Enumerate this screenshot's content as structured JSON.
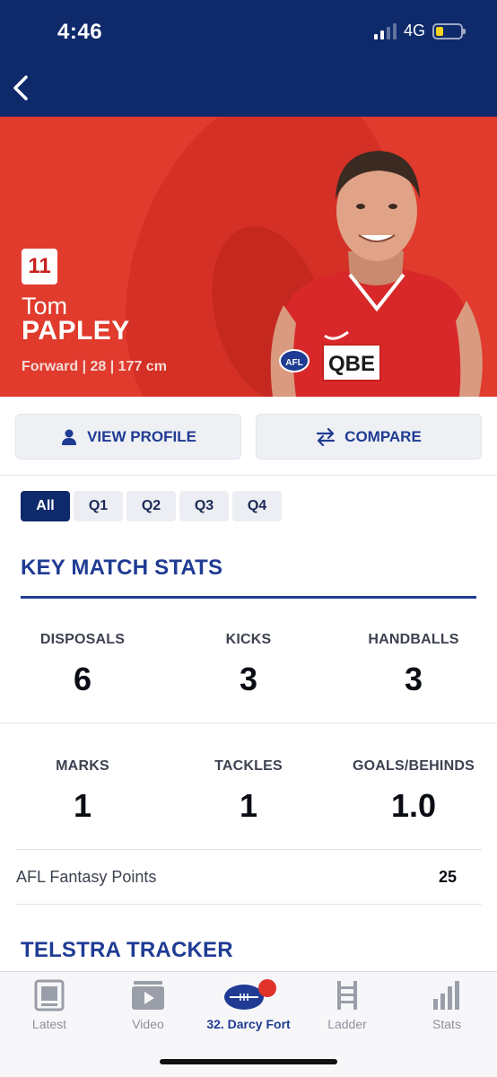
{
  "status_bar": {
    "time": "4:46",
    "network": "4G"
  },
  "header": {
    "back_icon": "chevron-left-icon"
  },
  "player": {
    "number": "11",
    "first_name": "Tom",
    "last_name": "PAPLEY",
    "meta": "Forward | 28 | 177 cm",
    "jersey_text": "QBE",
    "badge_text": "AFL"
  },
  "actions": {
    "view_profile": "VIEW PROFILE",
    "compare": "COMPARE"
  },
  "quarter_tabs": [
    "All",
    "Q1",
    "Q2",
    "Q3",
    "Q4"
  ],
  "selected_tab": "All",
  "key_match_stats": {
    "title": "KEY MATCH STATS",
    "row1": [
      {
        "label": "DISPOSALS",
        "value": "6"
      },
      {
        "label": "KICKS",
        "value": "3"
      },
      {
        "label": "HANDBALLS",
        "value": "3"
      }
    ],
    "row2": [
      {
        "label": "MARKS",
        "value": "1"
      },
      {
        "label": "TACKLES",
        "value": "1"
      },
      {
        "label": "GOALS/BEHINDS",
        "value": "1.0"
      }
    ],
    "fantasy_label": "AFL Fantasy Points",
    "fantasy_value": "25"
  },
  "tracker": {
    "title": "TELSTRA TRACKER"
  },
  "bottom_nav": [
    {
      "label": "Latest",
      "icon": "news-icon"
    },
    {
      "label": "Video",
      "icon": "video-icon"
    },
    {
      "label": "32. Darcy Fort",
      "icon": "football-icon"
    },
    {
      "label": "Ladder",
      "icon": "ladder-icon"
    },
    {
      "label": "Stats",
      "icon": "bar-chart-icon"
    }
  ],
  "colors": {
    "header_navy": "#0f2a6b",
    "hero_red": "#e03b2d",
    "accent_blue": "#1f3b93",
    "notification_red": "#e0322b"
  }
}
